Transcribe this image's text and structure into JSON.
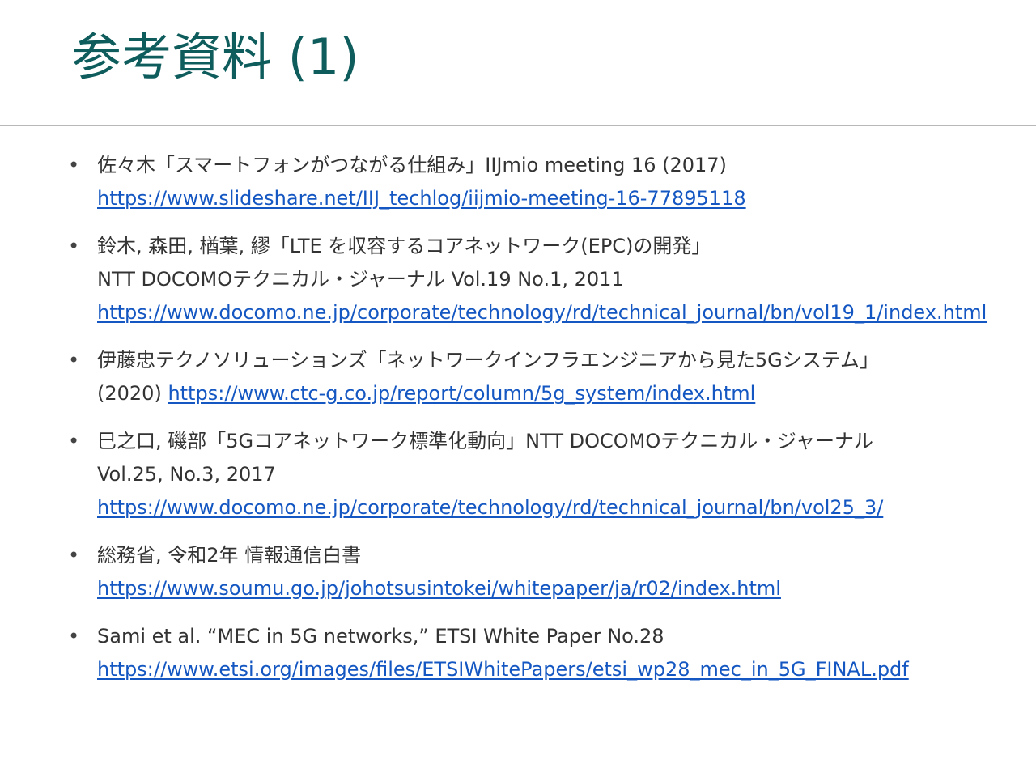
{
  "slide": {
    "title": "参考資料 (1)",
    "references": [
      {
        "lines": [
          "佐々木「スマートフォンがつながる仕組み」IIJmio meeting 16 (2017)"
        ],
        "url": "https://www.slideshare.net/IIJ_techlog/iijmio-meeting-16-77895118"
      },
      {
        "lines": [
          "鈴木, 森田, 楢葉, 繆「LTE を収容するコアネットワーク(EPC)の開発」",
          "NTT DOCOMOテクニカル・ジャーナル Vol.19 No.1, 2011"
        ],
        "url": "https://www.docomo.ne.jp/corporate/technology/rd/technical_journal/bn/vol19_1/index.html"
      },
      {
        "lines": [
          "伊藤忠テクノソリューションズ「ネットワークインフラエンジニアから見た5Gシステム」"
        ],
        "inline_prefix": "(2020) ",
        "url": "https://www.ctc-g.co.jp/report/column/5g_system/index.html"
      },
      {
        "lines": [
          "巳之口, 磯部「5Gコアネットワーク標準化動向」NTT DOCOMOテクニカル・ジャーナル",
          "Vol.25, No.3, 2017"
        ],
        "url": "https://www.docomo.ne.jp/corporate/technology/rd/technical_journal/bn/vol25_3/"
      },
      {
        "lines": [
          "総務省, 令和2年 情報通信白書"
        ],
        "url": "https://www.soumu.go.jp/johotsusintokei/whitepaper/ja/r02/index.html"
      },
      {
        "lines": [
          "Sami et al. “MEC in 5G networks,” ETSI White Paper No.28"
        ],
        "url": "https://www.etsi.org/images/files/ETSIWhitePapers/etsi_wp28_mec_in_5G_FINAL.pdf"
      }
    ]
  }
}
